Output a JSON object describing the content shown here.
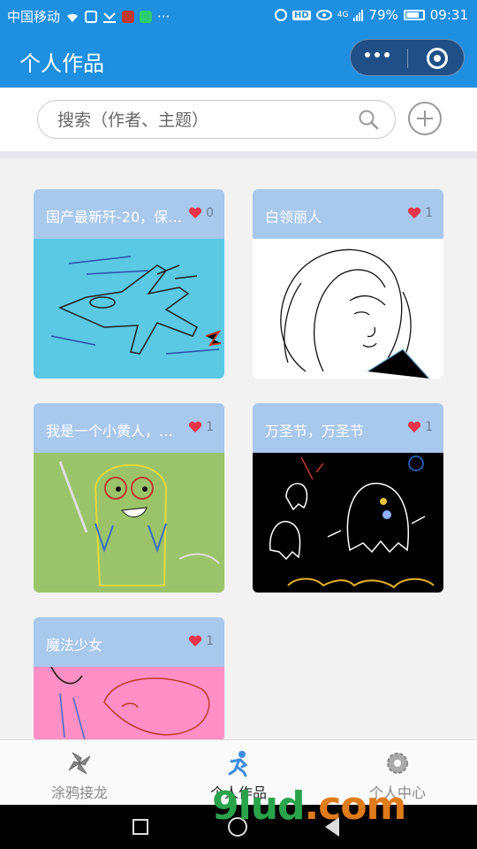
{
  "status_bar": {
    "carrier": "中国移动",
    "battery": "79%",
    "time": "09:31",
    "network": "4G"
  },
  "nav": {
    "title": "个人作品"
  },
  "search": {
    "placeholder": "搜索（作者、主题）"
  },
  "cards": [
    {
      "title": "国产最新歼-20，保…",
      "likes": "0",
      "image": "fighter-jet-doodle",
      "head_color": "#a8c8ec",
      "bg": "#5bc8e4"
    },
    {
      "title": "白领丽人",
      "likes": "1",
      "image": "woman-sketch",
      "head_color": "#a8c8ec",
      "bg": "#ffffff"
    },
    {
      "title": "我是一个小黄人，…",
      "likes": "1",
      "image": "minion-doodle",
      "head_color": "#a8c8ec",
      "bg": "#9bc46a"
    },
    {
      "title": "万圣节，万圣节",
      "likes": "1",
      "image": "ghosts-doodle",
      "head_color": "#a8c8ec",
      "bg": "#000000"
    },
    {
      "title": "魔法少女",
      "likes": "1",
      "image": "magic-girl-doodle",
      "head_color": "#a8c8ec",
      "bg": "#ff8fc4"
    }
  ],
  "tabs": [
    {
      "label": "涂鸦接龙",
      "icon": "pinwheel-icon"
    },
    {
      "label": "个人作品",
      "icon": "runner-icon",
      "active": true
    },
    {
      "label": "个人中心",
      "icon": "gear-icon"
    }
  ],
  "watermark": {
    "text": "9lud",
    "suffix": ".com"
  },
  "colors": {
    "primary": "#1e8fe1",
    "card_head": "#a8c8ec",
    "heart": "#e8334a"
  }
}
